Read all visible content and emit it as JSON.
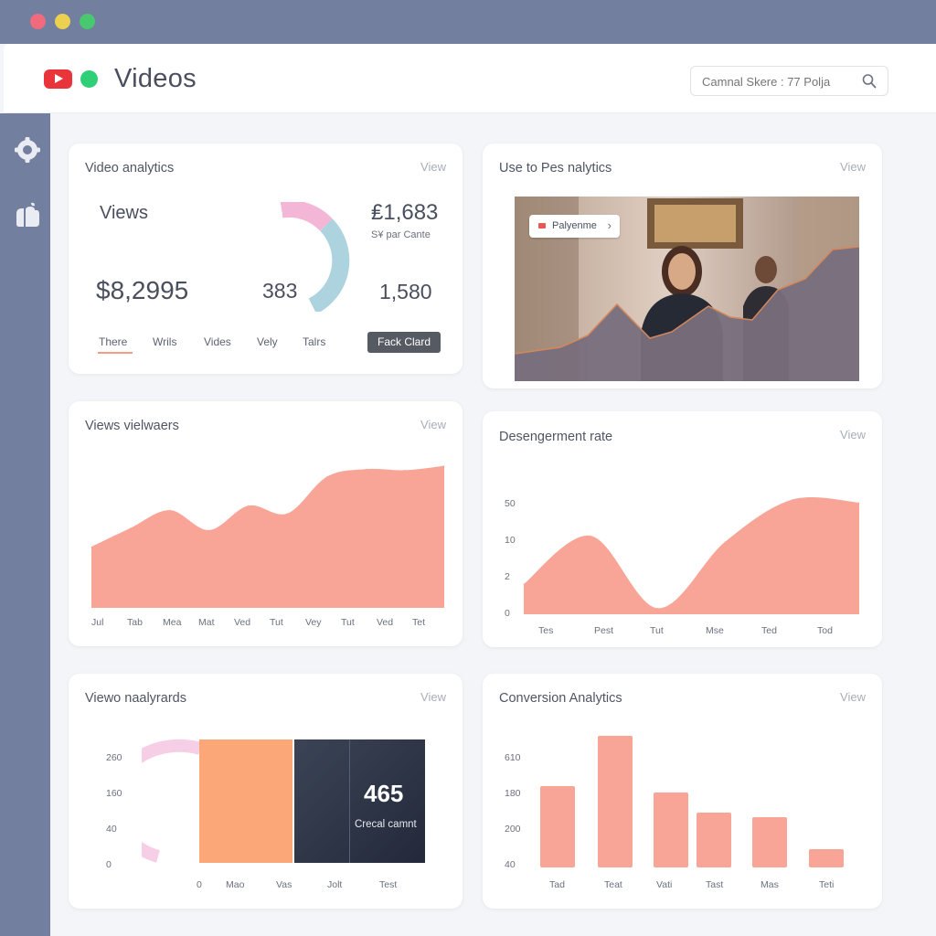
{
  "window": {
    "title": "Videos",
    "search_placeholder": "Camnal Skere : 77 Polja"
  },
  "colors": {
    "accent": "#f8a597",
    "sidebar": "#727f9f",
    "status_green": "#2fcf77",
    "youtube_red": "#e8343a"
  },
  "icons": {
    "sidebar": [
      "gear-icon",
      "apple-icon"
    ],
    "search": "search-icon"
  },
  "video_analytics": {
    "title": "Video analytics",
    "link": "View",
    "views_label": "Views",
    "value_right_top": "₤1,683",
    "sub_caption": "S¥ par Cante",
    "revenue": "$8,2995",
    "gauge_value": "383",
    "value_right_bottom": "1,580",
    "tabs": [
      "There",
      "Wrils",
      "Vides",
      "Vely",
      "Talrs"
    ],
    "button": "Fack Clard"
  },
  "user_analytics": {
    "title": "Use to Pes nalytics",
    "link": "View",
    "tag": "Palyenme"
  },
  "views_viewers": {
    "title": "Views vielwaers",
    "link": "View"
  },
  "engagement": {
    "title": "Desengerment rate",
    "link": "View"
  },
  "viewo_analyrards": {
    "title": "Viewo naalyrards",
    "link": "View",
    "badge_number": "465",
    "badge_caption": "Crecal camnt"
  },
  "conversion": {
    "title": "Conversion Analytics",
    "link": "View"
  },
  "chart_data": [
    {
      "type": "area",
      "title": "Views vielwaers",
      "categories": [
        "Jul",
        "Tab",
        "Mea",
        "Mat",
        "Ved",
        "Tut",
        "Vey",
        "Tut",
        "Ved",
        "Tet"
      ],
      "values": [
        55,
        72,
        88,
        70,
        92,
        85,
        118,
        125,
        124,
        128
      ],
      "ylim": [
        0,
        140
      ]
    },
    {
      "type": "area",
      "title": "Desengerment rate",
      "categories": [
        "Tes",
        "Pest",
        "Tut",
        "Mse",
        "Ted",
        "Tod"
      ],
      "yticks": [
        "50",
        "10",
        "2",
        "0"
      ],
      "values": [
        1,
        2.6,
        0.2,
        2.4,
        3.8,
        3.7
      ],
      "ylim": [
        0,
        4
      ]
    },
    {
      "type": "bar",
      "title": "Viewo naalyrards",
      "categories": [
        "0",
        "Mao",
        "Vas",
        "Jolt",
        "Test"
      ],
      "yticks": [
        "260",
        "160",
        "40",
        "0"
      ],
      "values": [
        200,
        200
      ]
    },
    {
      "type": "bar",
      "title": "Conversion Analytics",
      "categories": [
        "Tad",
        "Teat",
        "Vati",
        "Tast",
        "Mas",
        "Teti"
      ],
      "yticks": [
        "610",
        "180",
        "200",
        "40"
      ],
      "values": [
        0.62,
        1.0,
        0.57,
        0.42,
        0.38,
        0.14
      ]
    }
  ]
}
